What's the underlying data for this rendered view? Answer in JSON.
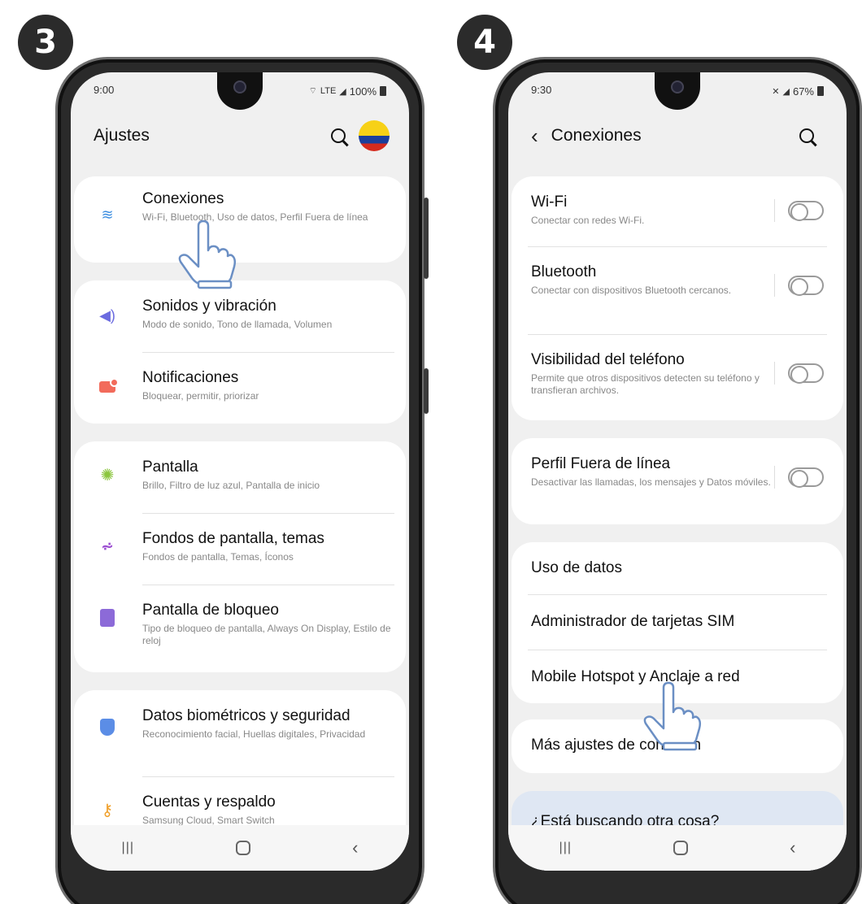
{
  "left_phone": {
    "step": "3",
    "status": {
      "time": "9:00",
      "battery": "100%",
      "lte": "LTE"
    },
    "appbar": {
      "title": "Ajustes"
    },
    "groups": [
      {
        "items": [
          {
            "title": "Conexiones",
            "subtitle": "Wi-Fi, Bluetooth, Uso de datos, Perfil Fuera de línea"
          }
        ]
      },
      {
        "items": [
          {
            "title": "Sonidos y vibración",
            "subtitle": "Modo de sonido, Tono de llamada, Volumen"
          },
          {
            "title": "Notificaciones",
            "subtitle": "Bloquear, permitir, priorizar"
          }
        ]
      },
      {
        "items": [
          {
            "title": "Pantalla",
            "subtitle": "Brillo, Filtro de luz azul, Pantalla de inicio"
          },
          {
            "title": "Fondos de pantalla, temas",
            "subtitle": "Fondos de pantalla, Temas, Íconos"
          },
          {
            "title": "Pantalla de bloqueo",
            "subtitle": "Tipo de bloqueo de pantalla, Always On Display, Estilo de reloj"
          }
        ]
      },
      {
        "items": [
          {
            "title": "Datos biométricos y seguridad",
            "subtitle": "Reconocimiento facial, Huellas digitales, Privacidad"
          },
          {
            "title": "Cuentas y respaldo",
            "subtitle": "Samsung Cloud, Smart Switch"
          }
        ]
      }
    ],
    "icons": [
      "wifi-icon",
      "sound-icon",
      "notification-icon",
      "display-icon",
      "wallpaper-icon",
      "lock-screen-icon",
      "shield-icon",
      "key-icon"
    ]
  },
  "right_phone": {
    "step": "4",
    "status": {
      "time": "9:30",
      "battery": "67%"
    },
    "appbar": {
      "title": "Conexiones"
    },
    "toggles": [
      {
        "title": "Wi-Fi",
        "subtitle": "Conectar con redes Wi-Fi.",
        "on": false
      },
      {
        "title": "Bluetooth",
        "subtitle": "Conectar con dispositivos Bluetooth cercanos.",
        "on": false
      },
      {
        "title": "Visibilidad del teléfono",
        "subtitle": "Permite que otros dispositivos detecten su teléfono y transfieran archivos.",
        "on": false
      }
    ],
    "offline": {
      "title": "Perfil Fuera de línea",
      "subtitle": "Desactivar las llamadas, los mensajes y Datos móviles.",
      "on": false
    },
    "links": [
      "Uso de datos",
      "Administrador de tarjetas SIM",
      "Mobile Hotspot y Anclaje a red"
    ],
    "more": "Más ajustes de conexión",
    "looking": "¿Está buscando otra cosa?"
  },
  "colors": {
    "screen_bg": "#f0f0f0",
    "card_bg": "#ffffff",
    "badge_bg": "#2b2b2b"
  }
}
